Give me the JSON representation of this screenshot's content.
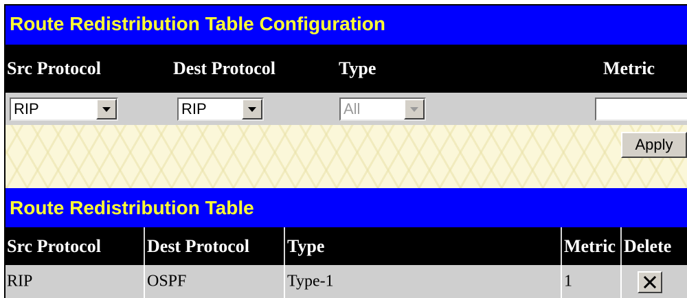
{
  "config": {
    "title": "Route Redistribution Table Configuration",
    "headers": {
      "src": "Src Protocol",
      "dest": "Dest Protocol",
      "type": "Type",
      "metric": "Metric"
    },
    "src_protocol": "RIP",
    "dest_protocol": "RIP",
    "type": "All",
    "metric_value": "",
    "apply_label": "Apply"
  },
  "table": {
    "title": "Route Redistribution Table",
    "headers": {
      "src": "Src Protocol",
      "dest": "Dest Protocol",
      "type": "Type",
      "metric": "Metric",
      "delete": "Delete"
    },
    "rows": [
      {
        "src": "RIP",
        "dest": "OSPF",
        "type": "Type-1",
        "metric": "1"
      }
    ]
  },
  "icons": {
    "delete": "close-icon",
    "dropdown": "chevron-down-icon"
  },
  "colors": {
    "title_bar": "#0000ff",
    "title_text": "#ffff33",
    "header_bg": "#000000",
    "header_text": "#ffffff",
    "row_bg": "#cfcfcf"
  }
}
